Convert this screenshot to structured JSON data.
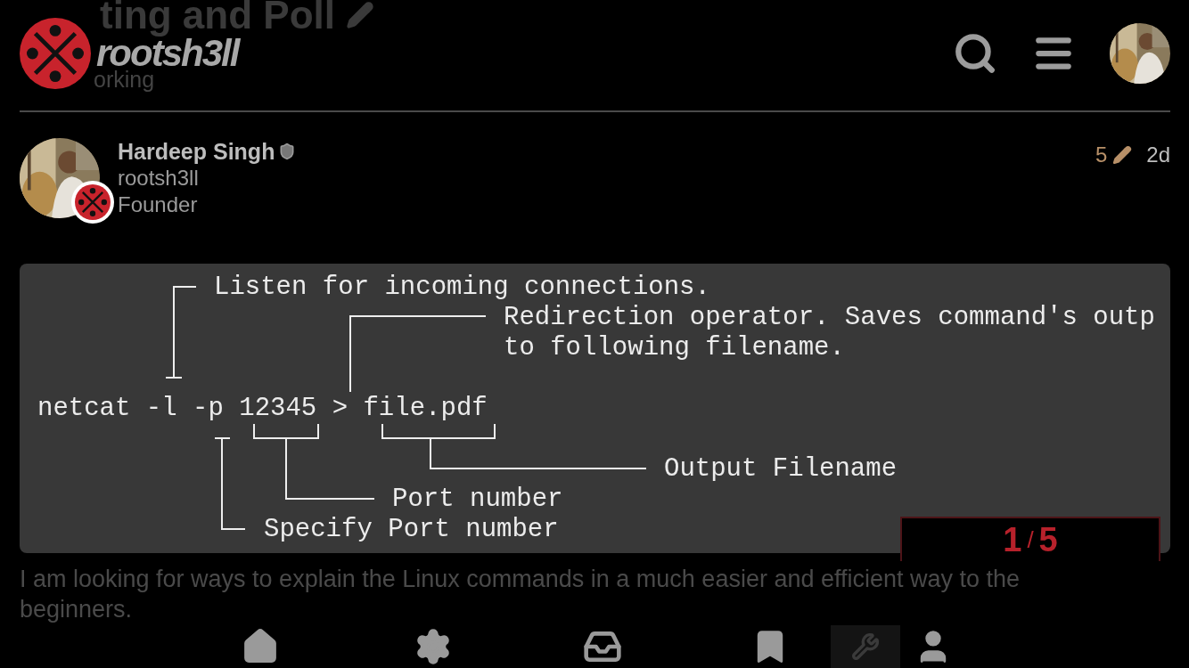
{
  "topic": {
    "title": "ting and Poll",
    "category": "orking"
  },
  "header": {
    "logo_text": "rootsh3ll"
  },
  "post": {
    "author_name": "Hardeep Singh",
    "username": "rootsh3ll",
    "user_title": "Founder",
    "edit_count": "5",
    "age": "2d",
    "diagram": {
      "command": "netcat -l -p 12345 > file.pdf",
      "annotations": [
        "Listen for incoming connections.",
        "Redirection operator. Saves command's outp",
        "to following filename.",
        "Output Filename",
        "Port number",
        "Specify Port number"
      ]
    },
    "body": "I am looking for ways to explain the Linux commands in a much easier and efficient way to the beginners."
  },
  "progress": {
    "current": "1",
    "separator": "/",
    "total": "5"
  },
  "bottom_nav": [
    {
      "kind": "home",
      "selected": false
    },
    {
      "kind": "settings",
      "selected": false
    },
    {
      "kind": "inbox",
      "selected": false
    },
    {
      "kind": "bookmark",
      "selected": false
    },
    {
      "kind": "wrench",
      "selected": true
    },
    {
      "kind": "user",
      "selected": false
    }
  ]
}
